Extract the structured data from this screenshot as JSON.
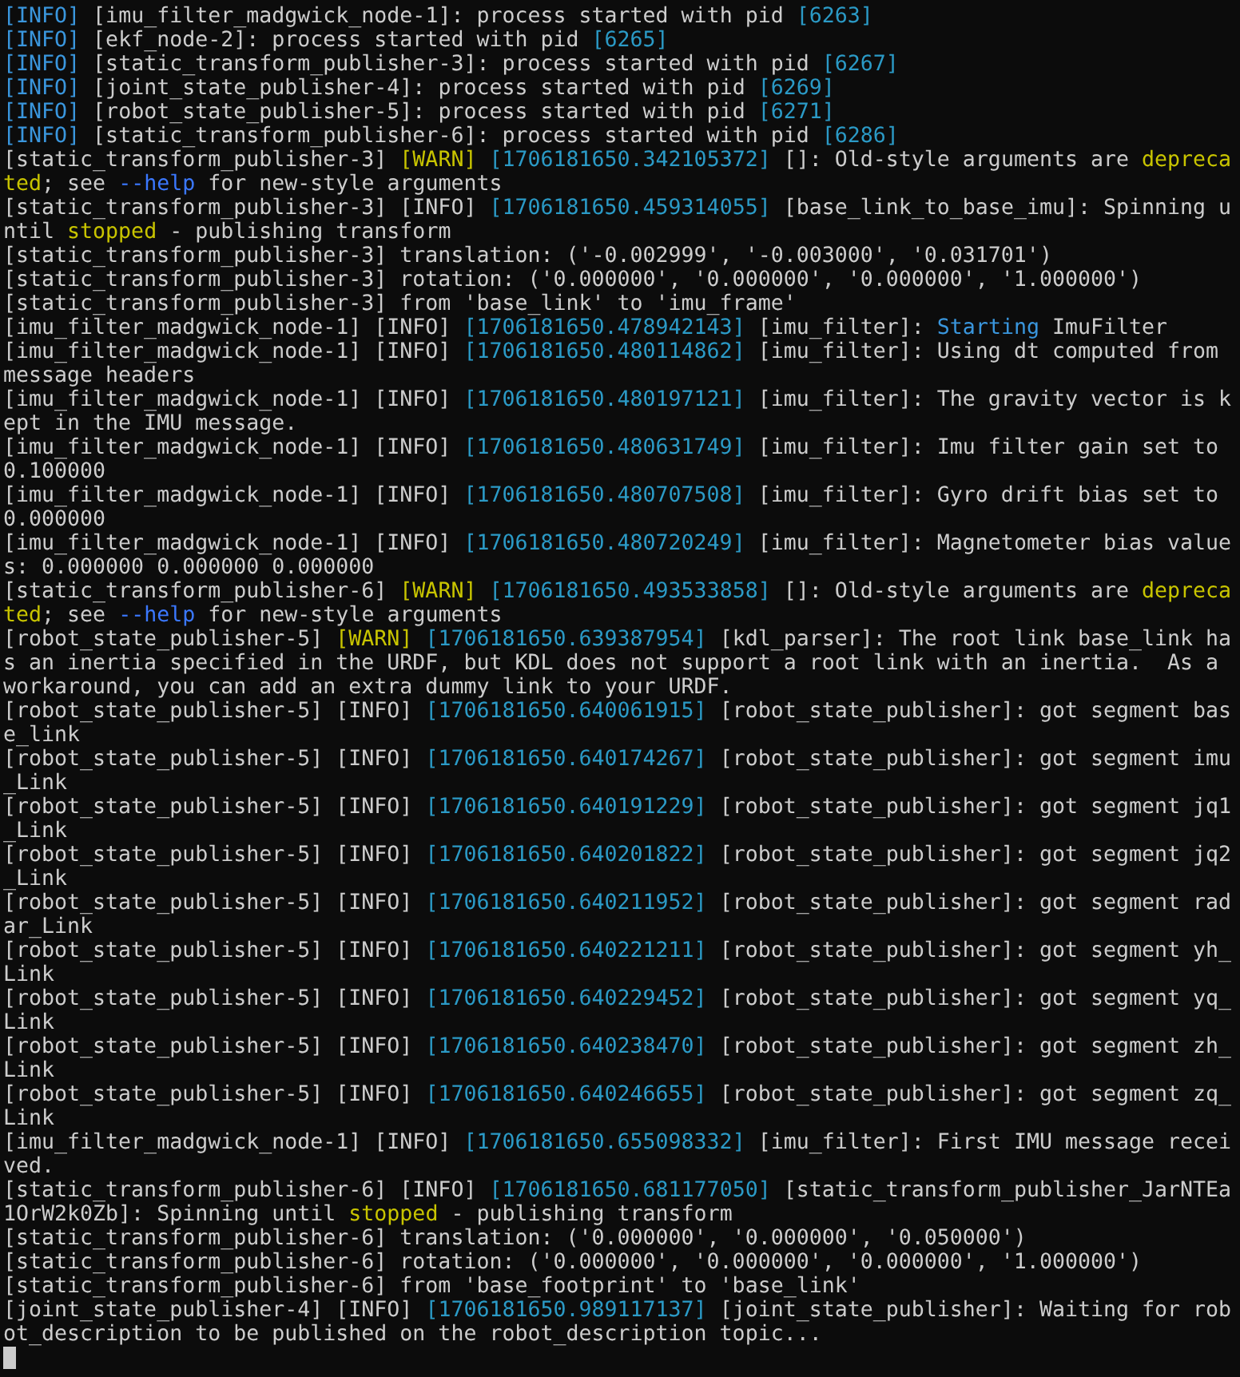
{
  "terminal": {
    "lines": [
      {
        "segments": [
          {
            "kind": "info",
            "text": "[INFO]"
          },
          {
            "kind": "text",
            "text": " [imu_filter_madgwick_node-1]: process started with pid "
          },
          {
            "kind": "stamp",
            "text": "[6263]"
          }
        ]
      },
      {
        "segments": [
          {
            "kind": "info",
            "text": "[INFO]"
          },
          {
            "kind": "text",
            "text": " [ekf_node-2]: process started with pid "
          },
          {
            "kind": "stamp",
            "text": "[6265]"
          }
        ]
      },
      {
        "segments": [
          {
            "kind": "info",
            "text": "[INFO]"
          },
          {
            "kind": "text",
            "text": " [static_transform_publisher-3]: process started with pid "
          },
          {
            "kind": "stamp",
            "text": "[6267]"
          }
        ]
      },
      {
        "segments": [
          {
            "kind": "info",
            "text": "[INFO]"
          },
          {
            "kind": "text",
            "text": " [joint_state_publisher-4]: process started with pid "
          },
          {
            "kind": "stamp",
            "text": "[6269]"
          }
        ]
      },
      {
        "segments": [
          {
            "kind": "info",
            "text": "[INFO]"
          },
          {
            "kind": "text",
            "text": " [robot_state_publisher-5]: process started with pid "
          },
          {
            "kind": "stamp",
            "text": "[6271]"
          }
        ]
      },
      {
        "segments": [
          {
            "kind": "info",
            "text": "[INFO]"
          },
          {
            "kind": "text",
            "text": " [static_transform_publisher-6]: process started with pid "
          },
          {
            "kind": "stamp",
            "text": "[6286]"
          }
        ]
      },
      {
        "segments": [
          {
            "kind": "text",
            "text": "[static_transform_publisher-3] "
          },
          {
            "kind": "warn",
            "text": "[WARN]"
          },
          {
            "kind": "stamp",
            "text": " [1706181650.342105372]"
          },
          {
            "kind": "text",
            "text": " []: Old-style arguments are "
          },
          {
            "kind": "warn",
            "text": "deprecated"
          },
          {
            "kind": "text",
            "text": "; see "
          },
          {
            "kind": "flag",
            "text": "--help"
          },
          {
            "kind": "text",
            "text": " for new-style arguments"
          }
        ]
      },
      {
        "segments": [
          {
            "kind": "text",
            "text": "[static_transform_publisher-3] [INFO] "
          },
          {
            "kind": "stamp",
            "text": "[1706181650.459314055]"
          },
          {
            "kind": "text",
            "text": " [base_link_to_base_imu]: Spinning until "
          },
          {
            "kind": "warn",
            "text": "stopped"
          },
          {
            "kind": "text",
            "text": " - publishing transform"
          }
        ]
      },
      {
        "segments": [
          {
            "kind": "text",
            "text": "[static_transform_publisher-3] translation: ('-0.002999', '-0.003000', '0.031701')"
          }
        ]
      },
      {
        "segments": [
          {
            "kind": "text",
            "text": "[static_transform_publisher-3] rotation: ('0.000000', '0.000000', '0.000000', '1.000000')"
          }
        ]
      },
      {
        "segments": [
          {
            "kind": "text",
            "text": "[static_transform_publisher-3] from 'base_link' to 'imu_frame'"
          }
        ]
      },
      {
        "segments": [
          {
            "kind": "text",
            "text": "[imu_filter_madgwick_node-1] [INFO] "
          },
          {
            "kind": "stamp",
            "text": "[1706181650.478942143]"
          },
          {
            "kind": "text",
            "text": " [imu_filter]: "
          },
          {
            "kind": "info",
            "text": "Starting"
          },
          {
            "kind": "text",
            "text": " ImuFilter"
          }
        ]
      },
      {
        "segments": [
          {
            "kind": "text",
            "text": "[imu_filter_madgwick_node-1] [INFO] "
          },
          {
            "kind": "stamp",
            "text": "[1706181650.480114862]"
          },
          {
            "kind": "text",
            "text": " [imu_filter]: Using dt computed from message headers"
          }
        ]
      },
      {
        "segments": [
          {
            "kind": "text",
            "text": "[imu_filter_madgwick_node-1] [INFO] "
          },
          {
            "kind": "stamp",
            "text": "[1706181650.480197121]"
          },
          {
            "kind": "text",
            "text": " [imu_filter]: The gravity vector is kept in the IMU message."
          }
        ]
      },
      {
        "segments": [
          {
            "kind": "text",
            "text": "[imu_filter_madgwick_node-1] [INFO] "
          },
          {
            "kind": "stamp",
            "text": "[1706181650.480631749]"
          },
          {
            "kind": "text",
            "text": " [imu_filter]: Imu filter gain set to 0.100000"
          }
        ]
      },
      {
        "segments": [
          {
            "kind": "text",
            "text": "[imu_filter_madgwick_node-1] [INFO] "
          },
          {
            "kind": "stamp",
            "text": "[1706181650.480707508]"
          },
          {
            "kind": "text",
            "text": " [imu_filter]: Gyro drift bias set to 0.000000"
          }
        ]
      },
      {
        "segments": [
          {
            "kind": "text",
            "text": "[imu_filter_madgwick_node-1] [INFO] "
          },
          {
            "kind": "stamp",
            "text": "[1706181650.480720249]"
          },
          {
            "kind": "text",
            "text": " [imu_filter]: Magnetometer bias values: 0.000000 0.000000 0.000000"
          }
        ]
      },
      {
        "segments": [
          {
            "kind": "text",
            "text": "[static_transform_publisher-6] "
          },
          {
            "kind": "warn",
            "text": "[WARN]"
          },
          {
            "kind": "stamp",
            "text": " [1706181650.493533858]"
          },
          {
            "kind": "text",
            "text": " []: Old-style arguments are "
          },
          {
            "kind": "warn",
            "text": "deprecated"
          },
          {
            "kind": "text",
            "text": "; see "
          },
          {
            "kind": "flag",
            "text": "--help"
          },
          {
            "kind": "text",
            "text": " for new-style arguments"
          }
        ]
      },
      {
        "segments": [
          {
            "kind": "text",
            "text": "[robot_state_publisher-5] "
          },
          {
            "kind": "warn",
            "text": "[WARN]"
          },
          {
            "kind": "stamp",
            "text": " [1706181650.639387954]"
          },
          {
            "kind": "text",
            "text": " [kdl_parser]: The root link base_link has an inertia specified in the URDF, but KDL does not support a root link with an inertia.  As a workaround, you can add an extra dummy link to your URDF."
          }
        ]
      },
      {
        "segments": [
          {
            "kind": "text",
            "text": "[robot_state_publisher-5] [INFO] "
          },
          {
            "kind": "stamp",
            "text": "[1706181650.640061915]"
          },
          {
            "kind": "text",
            "text": " [robot_state_publisher]: got segment base_link"
          }
        ]
      },
      {
        "segments": [
          {
            "kind": "text",
            "text": "[robot_state_publisher-5] [INFO] "
          },
          {
            "kind": "stamp",
            "text": "[1706181650.640174267]"
          },
          {
            "kind": "text",
            "text": " [robot_state_publisher]: got segment imu_Link"
          }
        ]
      },
      {
        "segments": [
          {
            "kind": "text",
            "text": "[robot_state_publisher-5] [INFO] "
          },
          {
            "kind": "stamp",
            "text": "[1706181650.640191229]"
          },
          {
            "kind": "text",
            "text": " [robot_state_publisher]: got segment jq1_Link"
          }
        ]
      },
      {
        "segments": [
          {
            "kind": "text",
            "text": "[robot_state_publisher-5] [INFO] "
          },
          {
            "kind": "stamp",
            "text": "[1706181650.640201822]"
          },
          {
            "kind": "text",
            "text": " [robot_state_publisher]: got segment jq2_Link"
          }
        ]
      },
      {
        "segments": [
          {
            "kind": "text",
            "text": "[robot_state_publisher-5] [INFO] "
          },
          {
            "kind": "stamp",
            "text": "[1706181650.640211952]"
          },
          {
            "kind": "text",
            "text": " [robot_state_publisher]: got segment radar_Link"
          }
        ]
      },
      {
        "segments": [
          {
            "kind": "text",
            "text": "[robot_state_publisher-5] [INFO] "
          },
          {
            "kind": "stamp",
            "text": "[1706181650.640221211]"
          },
          {
            "kind": "text",
            "text": " [robot_state_publisher]: got segment yh_Link"
          }
        ]
      },
      {
        "segments": [
          {
            "kind": "text",
            "text": "[robot_state_publisher-5] [INFO] "
          },
          {
            "kind": "stamp",
            "text": "[1706181650.640229452]"
          },
          {
            "kind": "text",
            "text": " [robot_state_publisher]: got segment yq_Link"
          }
        ]
      },
      {
        "segments": [
          {
            "kind": "text",
            "text": "[robot_state_publisher-5] [INFO] "
          },
          {
            "kind": "stamp",
            "text": "[1706181650.640238470]"
          },
          {
            "kind": "text",
            "text": " [robot_state_publisher]: got segment zh_Link"
          }
        ]
      },
      {
        "segments": [
          {
            "kind": "text",
            "text": "[robot_state_publisher-5] [INFO] "
          },
          {
            "kind": "stamp",
            "text": "[1706181650.640246655]"
          },
          {
            "kind": "text",
            "text": " [robot_state_publisher]: got segment zq_Link"
          }
        ]
      },
      {
        "segments": [
          {
            "kind": "text",
            "text": "[imu_filter_madgwick_node-1] [INFO] "
          },
          {
            "kind": "stamp",
            "text": "[1706181650.655098332]"
          },
          {
            "kind": "text",
            "text": " [imu_filter]: First IMU message received."
          }
        ]
      },
      {
        "segments": [
          {
            "kind": "text",
            "text": "[static_transform_publisher-6] [INFO] "
          },
          {
            "kind": "stamp",
            "text": "[1706181650.681177050]"
          },
          {
            "kind": "text",
            "text": " [static_transform_publisher_JarNTEa1OrW2k0Zb]: Spinning until "
          },
          {
            "kind": "warn",
            "text": "stopped"
          },
          {
            "kind": "text",
            "text": " - publishing transform"
          }
        ]
      },
      {
        "segments": [
          {
            "kind": "text",
            "text": "[static_transform_publisher-6] translation: ('0.000000', '0.000000', '0.050000')"
          }
        ]
      },
      {
        "segments": [
          {
            "kind": "text",
            "text": "[static_transform_publisher-6] rotation: ('0.000000', '0.000000', '0.000000', '1.000000')"
          }
        ]
      },
      {
        "segments": [
          {
            "kind": "text",
            "text": "[static_transform_publisher-6] from 'base_footprint' to 'base_link'"
          }
        ]
      },
      {
        "segments": [
          {
            "kind": "text",
            "text": "[joint_state_publisher-4] [INFO] "
          },
          {
            "kind": "stamp",
            "text": "[1706181650.989117137]"
          },
          {
            "kind": "text",
            "text": " [joint_state_publisher]: Waiting for robot_description to be published on the robot_description topic..."
          }
        ]
      }
    ]
  }
}
